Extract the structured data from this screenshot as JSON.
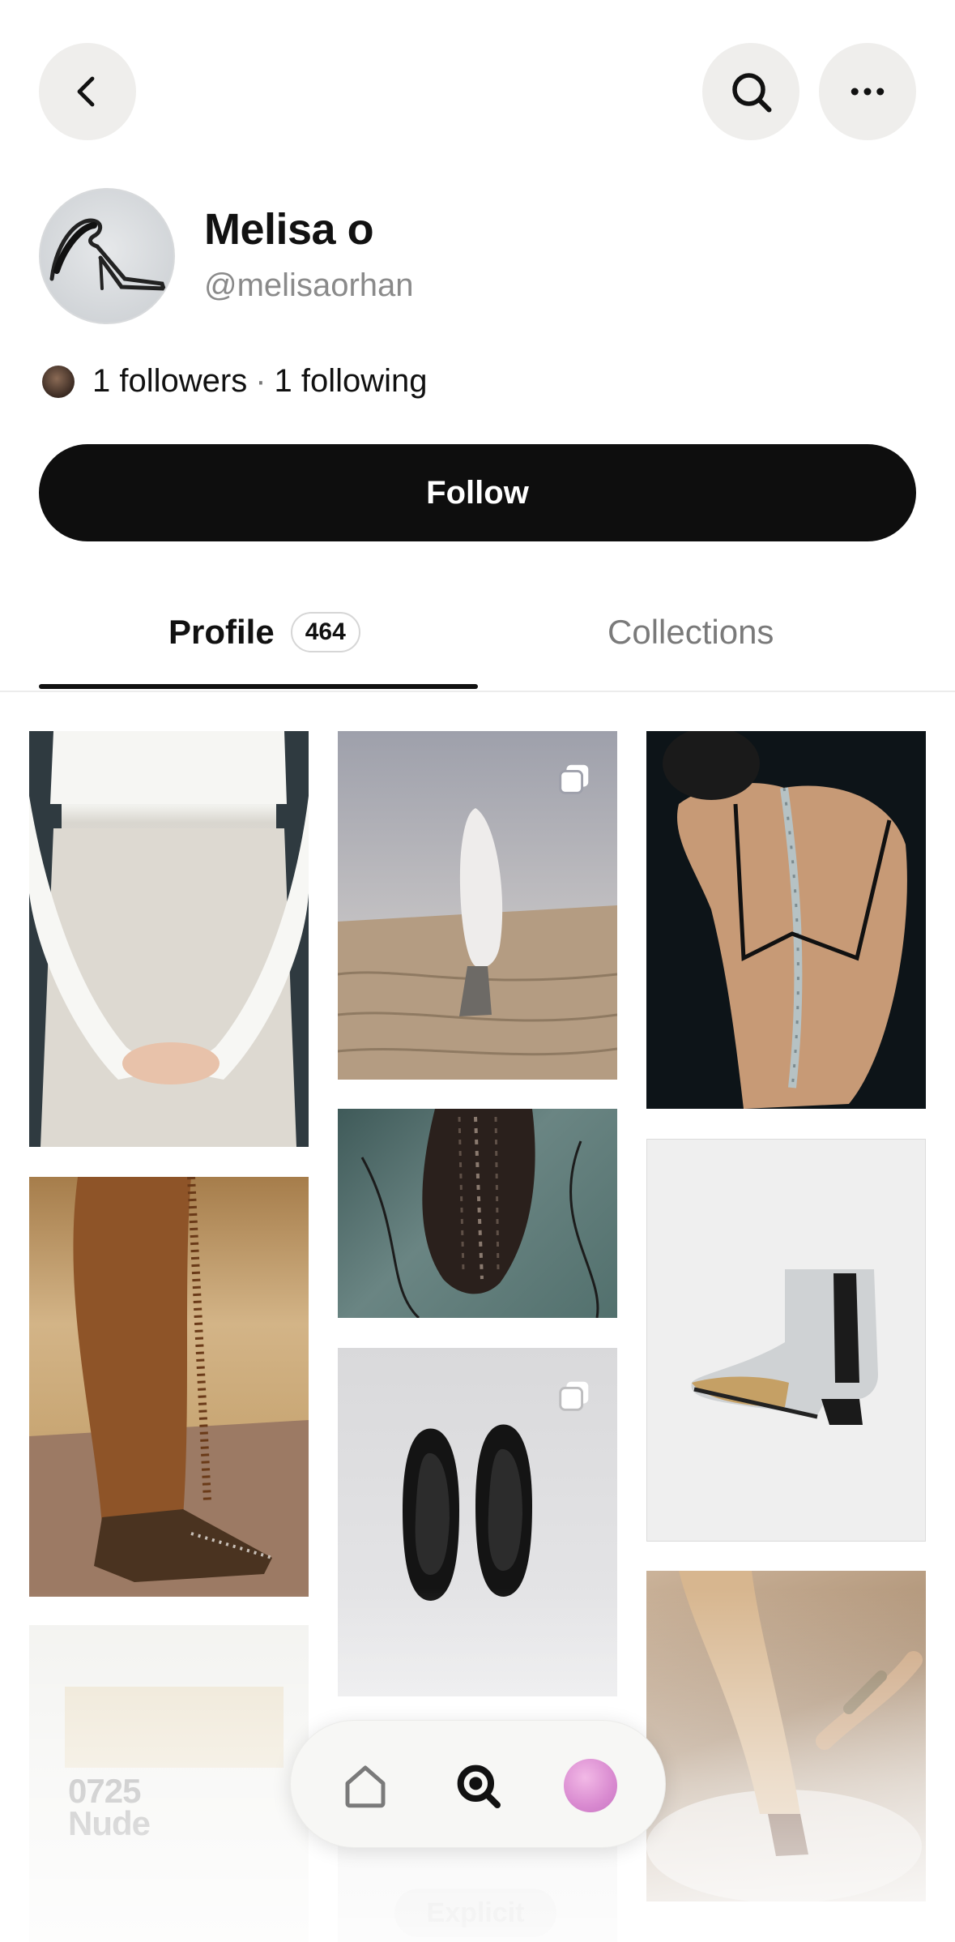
{
  "header": {
    "back_icon": "chevron-left-icon",
    "search_icon": "search-icon",
    "more_icon": "more-horizontal-icon"
  },
  "profile": {
    "name": "Melisa o",
    "handle": "@melisaorhan",
    "followers_text": "1 followers",
    "separator": "·",
    "following_text": "1 following",
    "follow_label": "Follow"
  },
  "tabs": [
    {
      "label": "Profile",
      "count": "464",
      "active": true
    },
    {
      "label": "Collections",
      "active": false
    }
  ],
  "grid": {
    "tile_8_text_line1": "0725",
    "tile_8_text_line2": "Nude",
    "tile_10_label": "Explicit"
  },
  "bottom_nav": {
    "items": [
      "home-icon",
      "search-icon",
      "profile-avatar"
    ],
    "active": "search-icon"
  },
  "colors": {
    "primary_button": "#0e0e0e",
    "icon_button_bg": "#efeeec",
    "secondary_text": "#8a8a8a"
  }
}
